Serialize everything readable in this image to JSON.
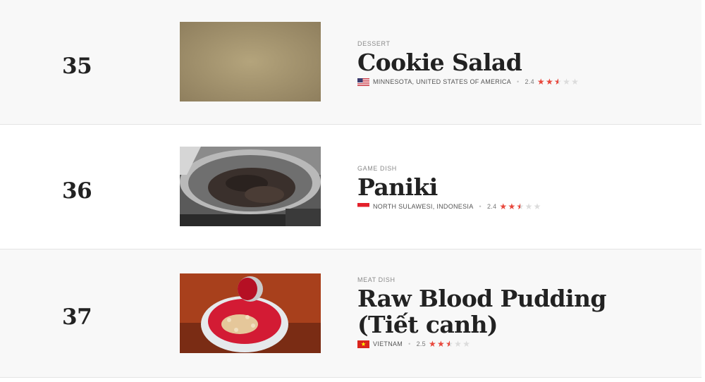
{
  "colors": {
    "star_active": "#e8473c",
    "star_inactive": "#dcdcdc",
    "row_alt_bg": "#f8f8f8"
  },
  "items": [
    {
      "rank": "35",
      "category": "DESSERT",
      "title": "Cookie Salad",
      "flag": "usa-flag-icon",
      "location": "MINNESOTA, UNITED STATES OF AMERICA",
      "rating": "2.4",
      "stars": {
        "full": 2,
        "half": 1,
        "empty": 2
      }
    },
    {
      "rank": "36",
      "category": "GAME DISH",
      "title": "Paniki",
      "flag": "indonesia-flag-icon",
      "location": "NORTH SULAWESI, INDONESIA",
      "rating": "2.4",
      "stars": {
        "full": 2,
        "half": 1,
        "empty": 2
      }
    },
    {
      "rank": "37",
      "category": "MEAT DISH",
      "title": "Raw Blood Pudding (Tiết canh)",
      "flag": "vietnam-flag-icon",
      "location": "VIETNAM",
      "rating": "2.5",
      "stars": {
        "full": 2,
        "half": 1,
        "empty": 2
      }
    }
  ]
}
